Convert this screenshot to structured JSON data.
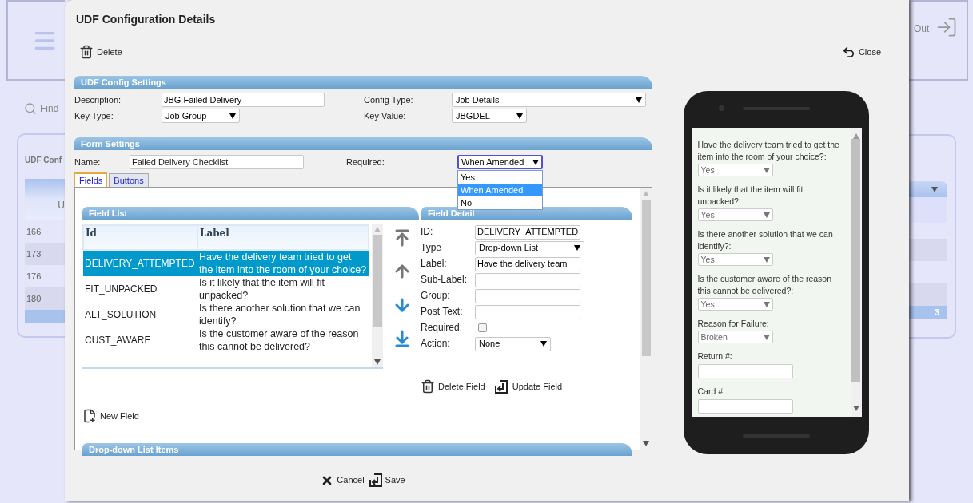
{
  "background": {
    "find": "Find",
    "card_title": "UDF Conf",
    "column_1": "U",
    "rows": [
      "166",
      "173",
      "176",
      "180"
    ],
    "logout": "Out",
    "page": "3"
  },
  "dialog": {
    "title": "UDF Configuration Details",
    "delete": "Delete",
    "close": "Close",
    "config_settings": {
      "title": "UDF Config Settings",
      "fields": [
        {
          "label": "Description:",
          "value": "JBG Failed Delivery",
          "kind": "text"
        },
        {
          "label": "Config Type:",
          "value": "Job Details",
          "kind": "select"
        },
        {
          "label": "Key Type:",
          "value": "Job Group",
          "kind": "select"
        },
        {
          "label": "Key Value:",
          "value": "JBGDEL",
          "kind": "select"
        }
      ]
    },
    "form_settings": {
      "title": "Form Settings",
      "name_label": "Name:",
      "name_value": "Failed Delivery Checklist",
      "required_label": "Required:",
      "required_value": "When Amended",
      "required_options": [
        {
          "label": "Yes",
          "selected": false
        },
        {
          "label": "When Amended",
          "selected": true
        },
        {
          "label": "No",
          "selected": false
        }
      ]
    },
    "tabs": [
      {
        "label": "Fields",
        "selected": true
      },
      {
        "label": "Buttons",
        "selected": false
      }
    ],
    "field_list": {
      "title": "Field List",
      "columns": [
        "Id",
        "Label"
      ],
      "rows": [
        {
          "id": "DELIVERY_ATTEMPTED",
          "label": "Have the delivery team tried to get the item into the room of your choice?",
          "selected": true
        },
        {
          "id": "FIT_UNPACKED",
          "label": "Is it likely that the item will fit unpacked?",
          "selected": false
        },
        {
          "id": "ALT_SOLUTION",
          "label": "Is there another solution that we can identify?",
          "selected": false
        },
        {
          "id": "CUST_AWARE",
          "label": "Is the customer aware of the reason this cannot be delivered?",
          "selected": false
        }
      ]
    },
    "new_field": "New Field",
    "field_detail": {
      "title": "Field Detail",
      "fields": [
        {
          "label": "ID:",
          "value": "DELIVERY_ATTEMPTED",
          "kind": "text"
        },
        {
          "label": "Type",
          "value": "Drop-down List",
          "kind": "select"
        },
        {
          "label": "Label:",
          "value": "Have the delivery team",
          "kind": "text"
        },
        {
          "label": "Sub-Label:",
          "kind": "text"
        },
        {
          "label": "Group:",
          "kind": "text"
        },
        {
          "label": "Post Text:",
          "kind": "text"
        },
        {
          "label": "Required:",
          "kind": "checkbox",
          "checked": false
        },
        {
          "label": "Action:",
          "value": "None",
          "kind": "select"
        }
      ],
      "delete": "Delete Field",
      "update": "Update Field"
    },
    "dropdown_items": {
      "title": "Drop-down List Items"
    },
    "cancel": "Cancel",
    "save": "Save"
  },
  "preview": {
    "questions": [
      {
        "label": "Have the delivery team tried to get the item into the room of your choice?:",
        "value": "Yes",
        "kind": "select"
      },
      {
        "label": "Is it likely that the item will fit unpacked?:",
        "value": "Yes",
        "kind": "select"
      },
      {
        "label": "Is there another solution that we can identify?:",
        "value": "Yes",
        "kind": "select"
      },
      {
        "label": "Is the customer aware of the reason this cannot be delivered?:",
        "value": "Yes",
        "kind": "select"
      },
      {
        "label": "Reason for Failure:",
        "value": "Broken",
        "kind": "select"
      },
      {
        "label": "Return #:",
        "kind": "text"
      },
      {
        "label": "Card #:",
        "kind": "text"
      }
    ]
  }
}
